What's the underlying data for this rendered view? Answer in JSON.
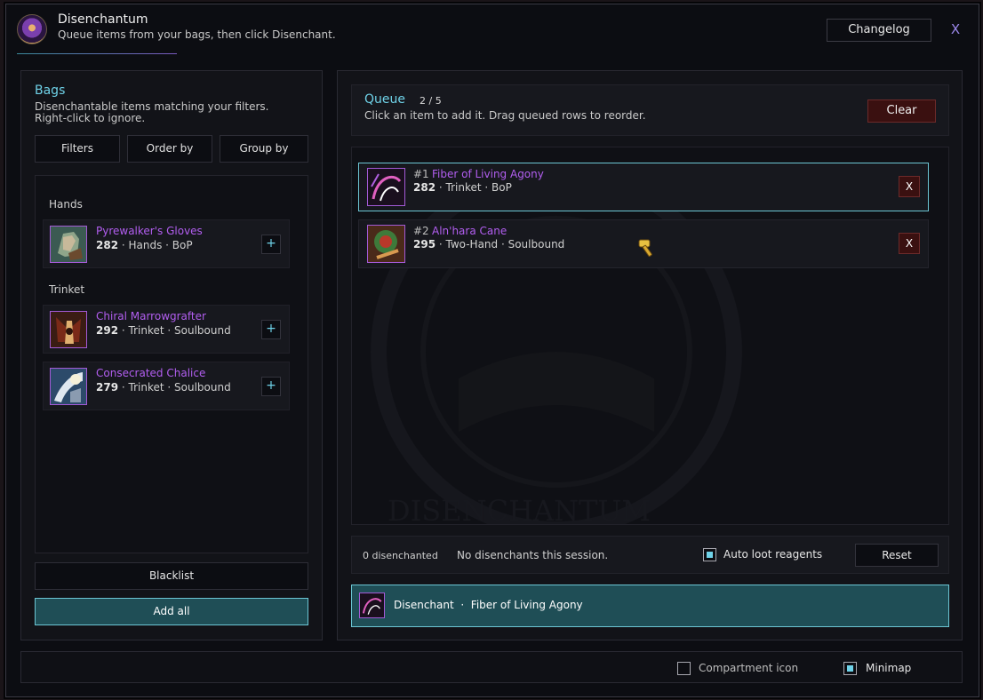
{
  "window": {
    "title": "Disenchantum",
    "subtitle": "Queue items from your bags, then click Disenchant.",
    "changelog_label": "Changelog",
    "close_label": "X"
  },
  "bags": {
    "title": "Bags",
    "description": "Disenchantable items matching your filters. Right-click to ignore.",
    "toolbar": {
      "filters": "Filters",
      "order_by": "Order by",
      "group_by": "Group by"
    },
    "groups": [
      {
        "label": "Hands",
        "items": [
          {
            "name": "Pyrewalker's Gloves",
            "ilvl": "282",
            "meta": " · Hands · BoP",
            "icon": "gloves-icon"
          }
        ]
      },
      {
        "label": "Trinket",
        "items": [
          {
            "name": "Chiral Marrowgrafter",
            "ilvl": "292",
            "meta": " · Trinket · Soulbound",
            "icon": "marrowgrafter-icon"
          },
          {
            "name": "Consecrated Chalice",
            "ilvl": "279",
            "meta": " · Trinket · Soulbound",
            "icon": "chalice-icon"
          }
        ]
      }
    ],
    "add_symbol": "+",
    "blacklist_label": "Blacklist",
    "add_all_label": "Add all"
  },
  "queue": {
    "title": "Queue",
    "count": "2 / 5",
    "description": "Click an item to add it. Drag queued rows to reorder.",
    "clear_label": "Clear",
    "rows": [
      {
        "num": "#1",
        "name": "Fiber of Living Agony",
        "ilvl": "282",
        "meta": " · Trinket · BoP",
        "icon": "fiber-icon",
        "active": true
      },
      {
        "num": "#2",
        "name": "Aln'hara Cane",
        "ilvl": "295",
        "meta": " · Two-Hand · Soulbound",
        "icon": "cane-icon",
        "active": false
      }
    ],
    "remove_label": "X",
    "watermark_text": "DISENCHANTUM"
  },
  "status": {
    "count": "0 disenchanted",
    "message": "No disenchants this session.",
    "auto_loot_label": "Auto loot reagents",
    "auto_loot_checked": true,
    "reset_label": "Reset"
  },
  "disenchant_button": {
    "action": "Disenchant",
    "separator": "·",
    "target": "Fiber of Living Agony"
  },
  "footer": {
    "compartment_label": "Compartment icon",
    "compartment_checked": false,
    "minimap_label": "Minimap",
    "minimap_checked": true
  },
  "colors": {
    "accent_cyan": "#6fd2e8",
    "epic_purple": "#b25ef0",
    "danger_red": "#3a1010",
    "primary_teal": "#1f4e56"
  }
}
